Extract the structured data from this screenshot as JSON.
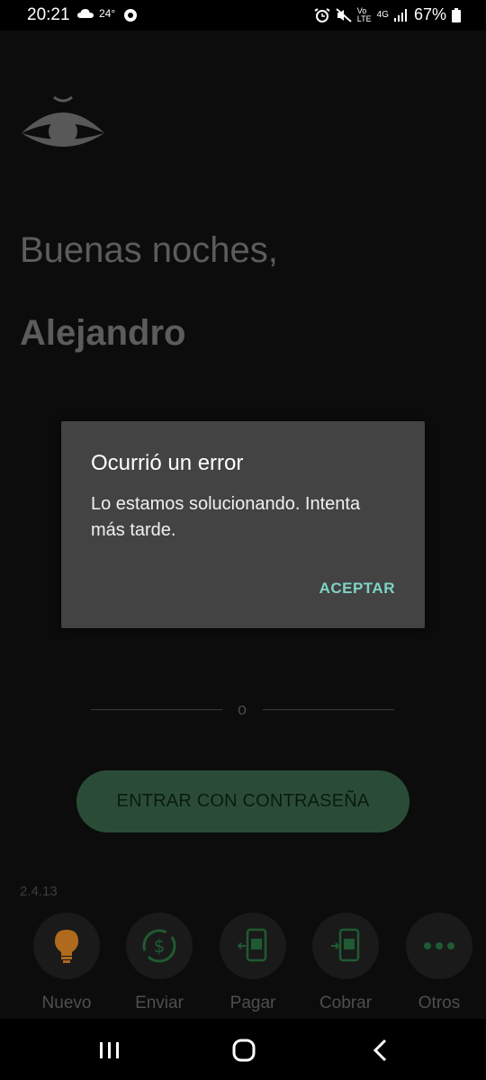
{
  "status": {
    "time": "20:21",
    "temp": "24°",
    "battery": "67%",
    "network": "4G"
  },
  "app": {
    "greeting": "Buenas noches,",
    "username": "Alejandro",
    "divider_text": "o",
    "enter_button": "ENTRAR CON CONTRASEÑA",
    "version": "2.4.13",
    "actions": [
      {
        "label": "Nuevo",
        "icon": "lightbulb-icon"
      },
      {
        "label": "Enviar",
        "icon": "money-transfer-icon"
      },
      {
        "label": "Pagar",
        "icon": "pay-phone-icon"
      },
      {
        "label": "Cobrar",
        "icon": "receive-phone-icon"
      },
      {
        "label": "Otros",
        "icon": "more-dots-icon"
      }
    ]
  },
  "dialog": {
    "title": "Ocurrió un error",
    "message": "Lo estamos solucionando. Intenta más tarde.",
    "accept": "ACEPTAR"
  },
  "colors": {
    "accent": "#7fd3c6",
    "button_green": "#2a4c37",
    "dialog_bg": "#434343",
    "icon_orange": "#b06a1e",
    "icon_green": "#1f5a32"
  }
}
